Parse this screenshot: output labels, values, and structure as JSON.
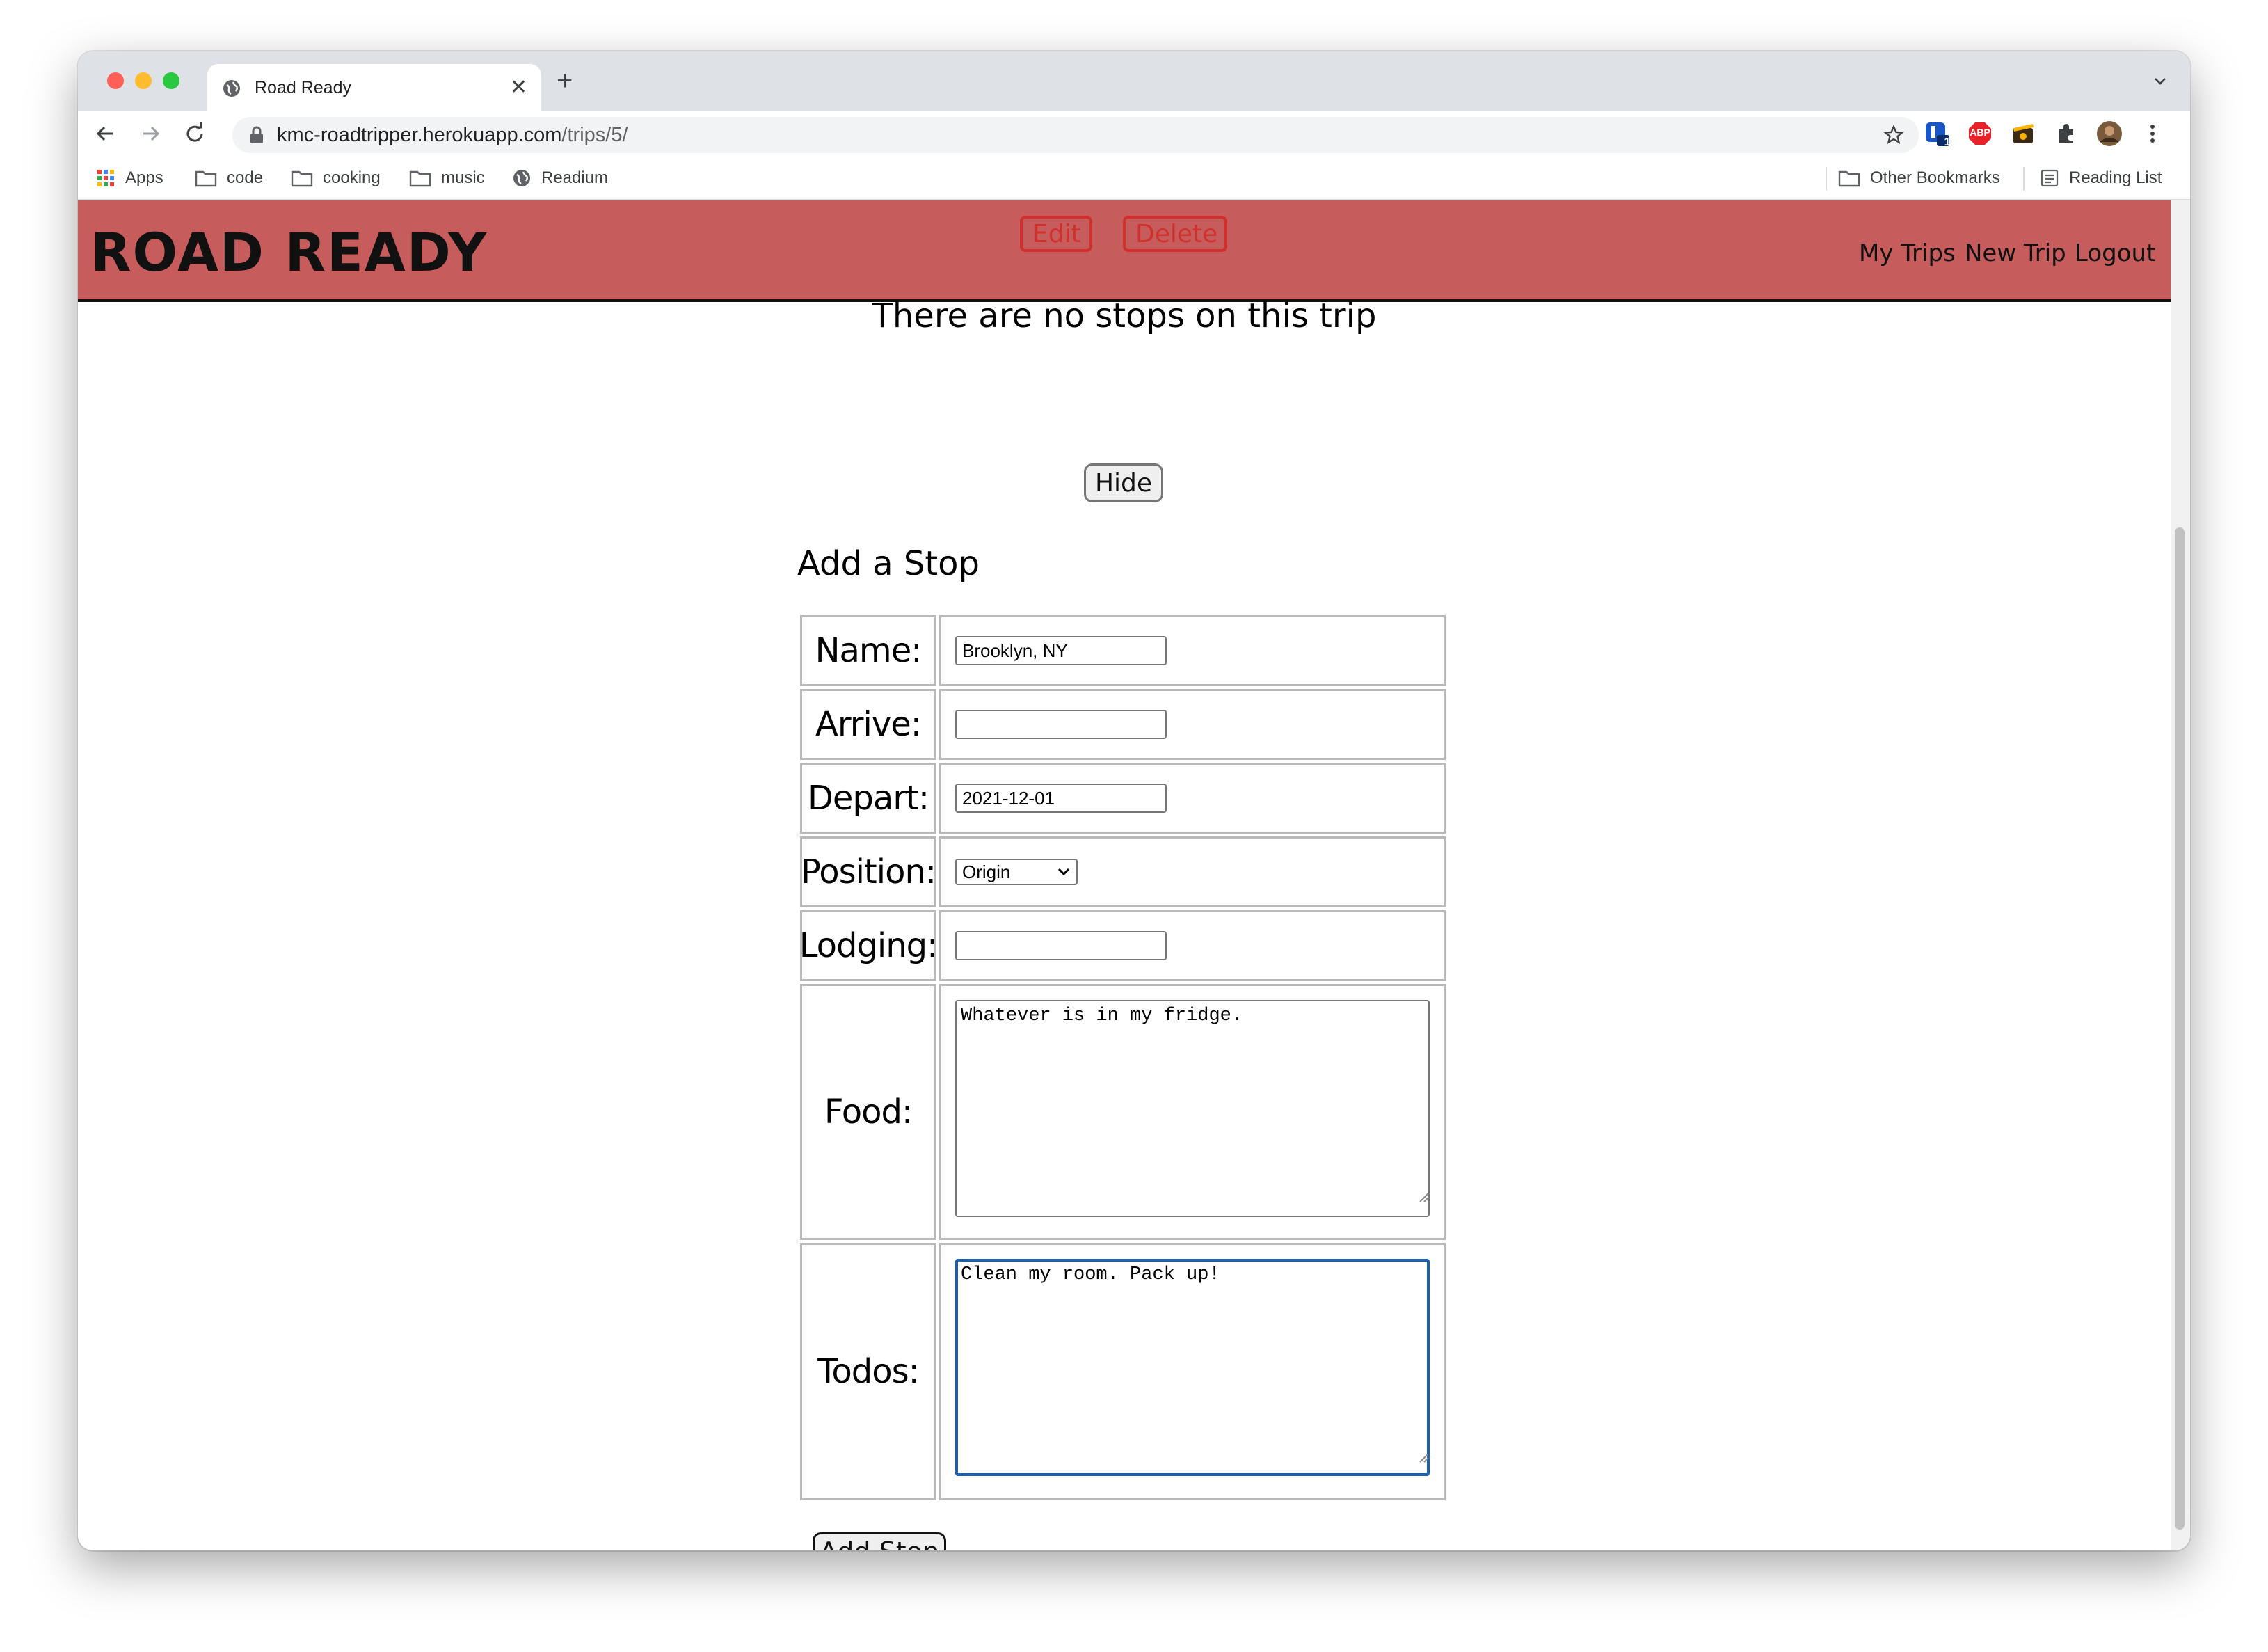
{
  "browser": {
    "tab_title": "Road Ready",
    "url_domain": "kmc-roadtripper.herokuapp.com",
    "url_path": "/trips/5/",
    "bookmarks": [
      "Apps",
      "code",
      "cooking",
      "music",
      "Readium"
    ],
    "other_bookmarks": "Other Bookmarks",
    "reading_list": "Reading List",
    "extension_badge": "1",
    "abp_label": "ABP"
  },
  "header": {
    "site_title": "ROAD READY",
    "edit_label": "Edit",
    "delete_label": "Delete",
    "nav": [
      "My Trips",
      "New Trip",
      "Logout"
    ],
    "brand_color": "#c75c5c"
  },
  "main": {
    "no_stops_text": "There are no stops on this trip",
    "hide_label": "Hide",
    "add_stop_heading": "Add a Stop",
    "form": {
      "name_label": "Name:",
      "name_value": "Brooklyn, NY",
      "arrive_label": "Arrive:",
      "arrive_value": "",
      "depart_label": "Depart:",
      "depart_value": "2021-12-01",
      "position_label": "Position:",
      "position_value": "Origin",
      "lodging_label": "Lodging:",
      "lodging_value": "",
      "food_label": "Food:",
      "food_value": "Whatever is in my fridge.",
      "todos_label": "Todos:",
      "todos_value": "Clean my room. Pack up!"
    },
    "submit_label": "Add Stop"
  }
}
